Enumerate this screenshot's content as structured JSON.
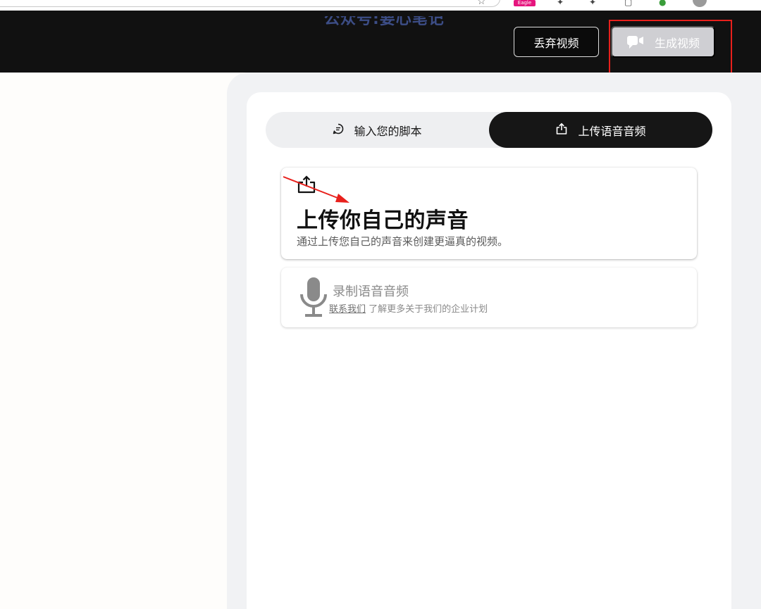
{
  "watermark": "公众号:要心笔记",
  "browser": {
    "extension_badge": "Eagle"
  },
  "header": {
    "discard_label": "丢弃视频",
    "generate_label": "生成视频"
  },
  "tabs": [
    {
      "label": "输入您的脚本",
      "icon": "chat-bubble-icon",
      "active": false
    },
    {
      "label": "上传语音音频",
      "icon": "upload-icon",
      "active": true
    }
  ],
  "upload_card": {
    "icon": "upload-icon",
    "title": "上传你自己的声音",
    "description": "通过上传您自己的声音来创建更逼真的视频。"
  },
  "record_card": {
    "icon": "microphone-icon",
    "title": "录制语音音频",
    "contact_link": "联系我们",
    "subtitle_rest": " 了解更多关于我们的企业计划"
  },
  "colors": {
    "header_bg": "#111111",
    "active_tab_bg": "#161616",
    "generate_button_bg": "#cfcfd3",
    "annotation_red": "#e8201c",
    "panel_bg": "#f1f2f4"
  }
}
